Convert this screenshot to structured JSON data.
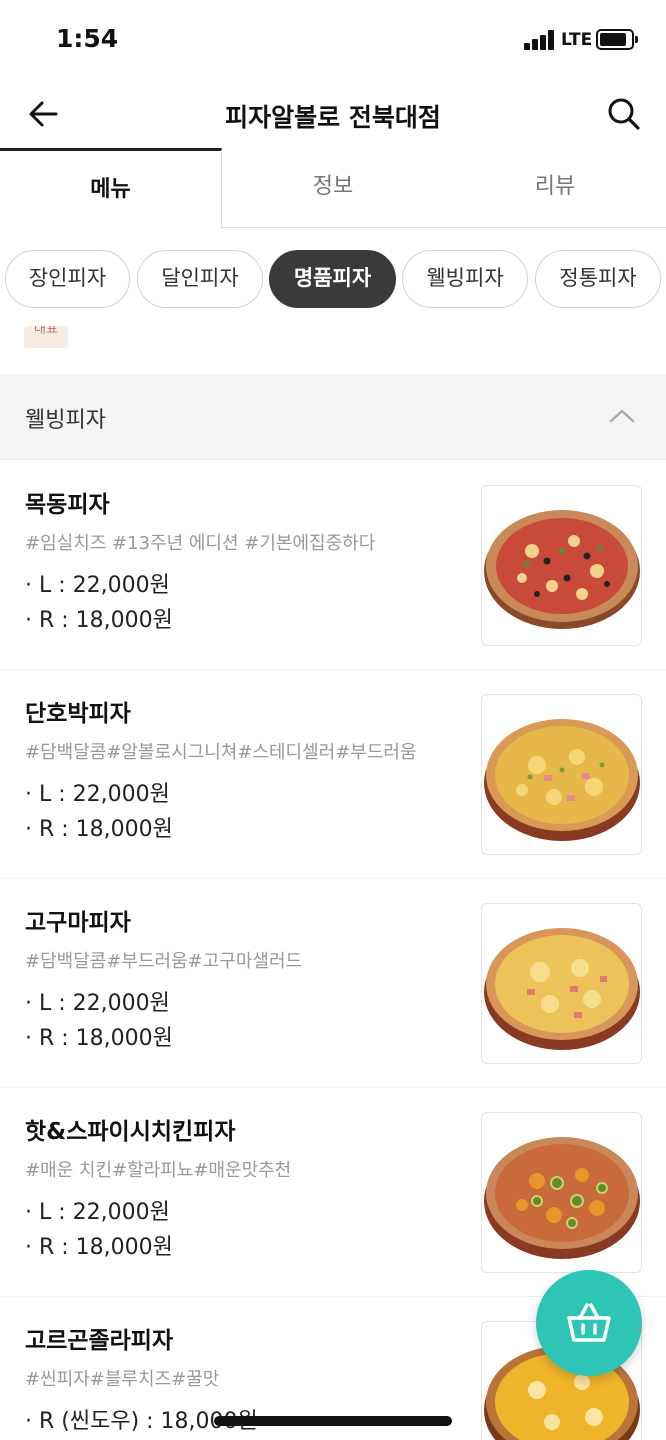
{
  "status_bar": {
    "time": "1:54",
    "network": "LTE"
  },
  "header": {
    "title": "피자알볼로 전북대점",
    "back_icon": "arrow-left-icon",
    "search_icon": "search-icon"
  },
  "tabs": [
    {
      "label": "메뉴",
      "active": true
    },
    {
      "label": "정보",
      "active": false
    },
    {
      "label": "리뷰",
      "active": false
    }
  ],
  "categories": [
    {
      "label": "장인피자",
      "active": false
    },
    {
      "label": "달인피자",
      "active": false
    },
    {
      "label": "명품피자",
      "active": true
    },
    {
      "label": "웰빙피자",
      "active": false
    },
    {
      "label": "정통피자",
      "active": false
    }
  ],
  "section": {
    "title": "웰빙피자",
    "collapse_icon": "chevron-up-icon"
  },
  "menu_items": [
    {
      "name": "목동피자",
      "tags": "#임실치즈 #13주년 에디션 #기본에집중하다",
      "price_l": "· L : 22,000원",
      "price_r": "· R : 18,000원",
      "image_icon": "pizza-image"
    },
    {
      "name": "단호박피자",
      "tags": "#담백달콤#알볼로시그니쳐#스테디셀러#부드러움",
      "price_l": "· L : 22,000원",
      "price_r": "· R : 18,000원",
      "image_icon": "pizza-image"
    },
    {
      "name": "고구마피자",
      "tags": "#담백달콤#부드러움#고구마샐러드",
      "price_l": "· L : 22,000원",
      "price_r": "· R : 18,000원",
      "image_icon": "pizza-image"
    },
    {
      "name": "핫&스파이시치킨피자",
      "tags": "#매운 치킨#할라피뇨#매운맛추천",
      "price_l": "· L : 22,000원",
      "price_r": "· R : 18,000원",
      "image_icon": "pizza-image"
    },
    {
      "name": "고르곤졸라피자",
      "tags": "#씬피자#블루치즈#꿀맛",
      "price_l": "· R (씬도우) : 18,000원",
      "price_r": "",
      "image_icon": "pizza-image"
    }
  ],
  "cart": {
    "icon": "basket-icon"
  },
  "colors": {
    "accent": "#2ec4b6",
    "chip_active": "#3a3a3a",
    "section_bg": "#f4f4f4"
  }
}
